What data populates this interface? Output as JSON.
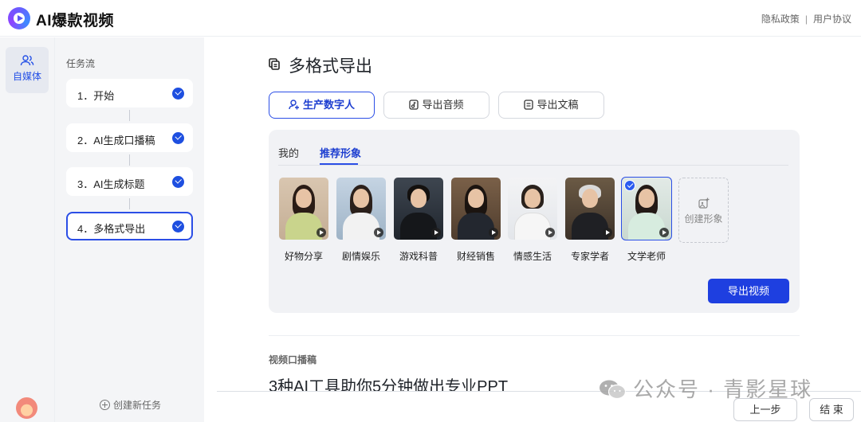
{
  "app": {
    "title": "AI爆款视频"
  },
  "top_links": {
    "privacy": "隐私政策",
    "separator": "|",
    "agreement": "用户协议"
  },
  "rail": {
    "item_label": "自媒体"
  },
  "workflow": {
    "title": "任务流",
    "steps": [
      {
        "label": "1．开始"
      },
      {
        "label": "2．AI生成口播稿"
      },
      {
        "label": "3．AI生成标题"
      },
      {
        "label": "4．多格式导出"
      }
    ],
    "new_task": "创建新任务"
  },
  "main": {
    "title": "多格式导出",
    "tabs": [
      {
        "label": "生产数字人"
      },
      {
        "label": "导出音频"
      },
      {
        "label": "导出文稿"
      }
    ],
    "subtabs": [
      {
        "label": "我的"
      },
      {
        "label": "推荐形象"
      }
    ],
    "avatars": [
      {
        "label": "好物分享"
      },
      {
        "label": "剧情娱乐"
      },
      {
        "label": "游戏科普"
      },
      {
        "label": "财经销售"
      },
      {
        "label": "情感生活"
      },
      {
        "label": "专家学者"
      },
      {
        "label": "文学老师"
      }
    ],
    "selected_avatar": "文学老师",
    "create_avatar": "创建形象",
    "export_button": "导出视频",
    "section_label": "视频口播稿",
    "script_title": "3种AI工具助你5分钟做出专业PPT"
  },
  "footer": {
    "prev": "上一步",
    "end": "结 束"
  },
  "watermark": {
    "text": "公众号 · 青影星球"
  },
  "colors": {
    "accent": "#2b4ee6",
    "primary_button": "#1e3fe0",
    "panel_bg": "#f1f2f5"
  }
}
